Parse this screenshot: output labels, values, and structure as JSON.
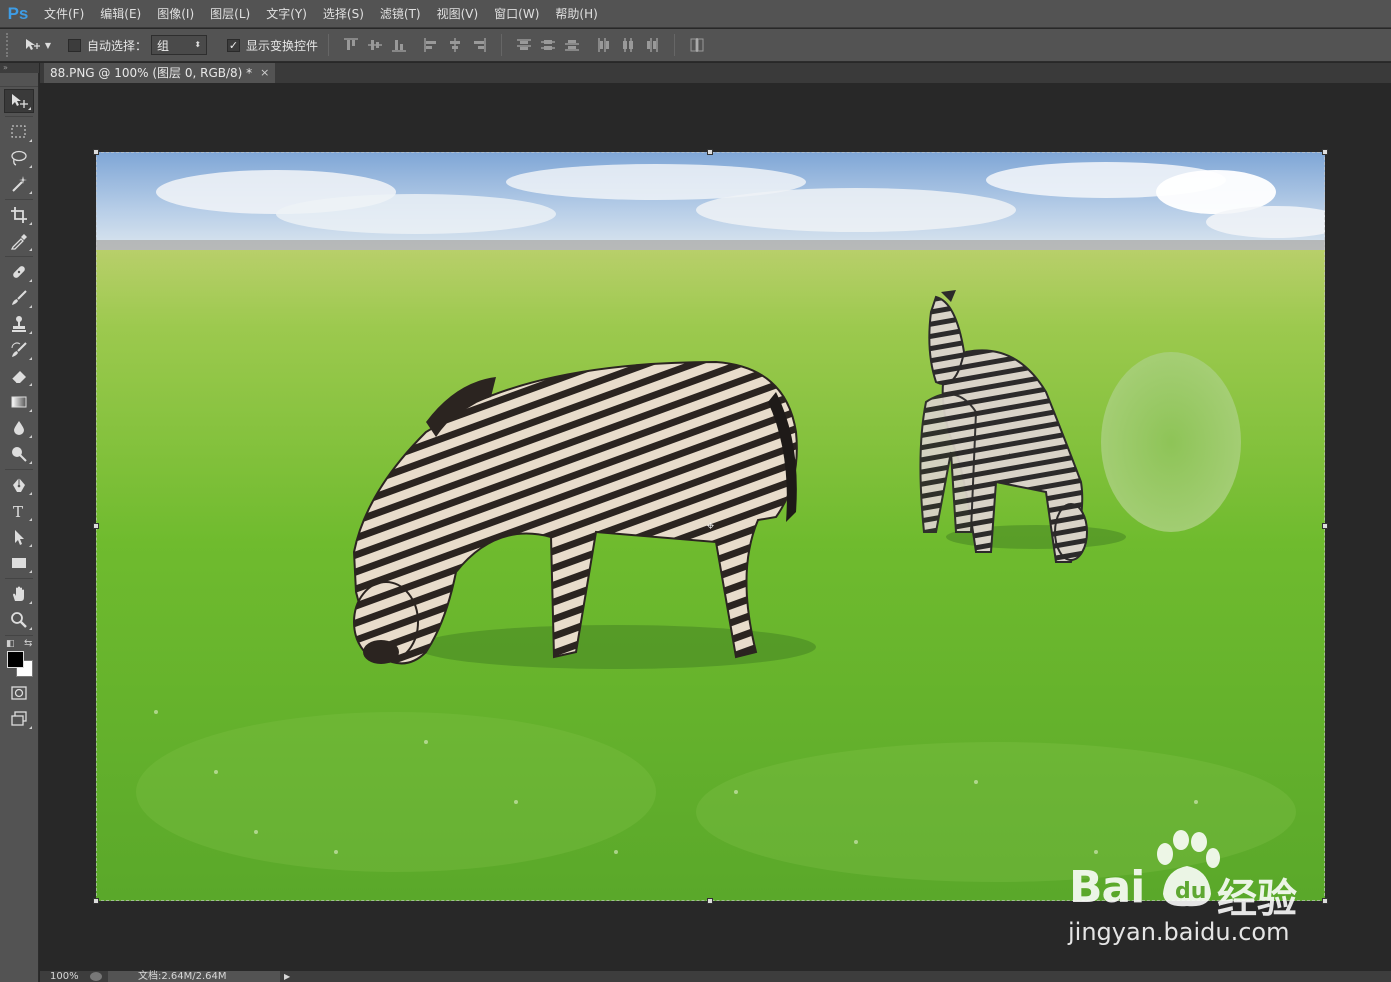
{
  "app": {
    "logo": "Ps"
  },
  "menu": [
    "文件(F)",
    "编辑(E)",
    "图像(I)",
    "图层(L)",
    "文字(Y)",
    "选择(S)",
    "滤镜(T)",
    "视图(V)",
    "窗口(W)",
    "帮助(H)"
  ],
  "options": {
    "auto_select_label": "自动选择：",
    "auto_select_checked": false,
    "auto_select_value": "组",
    "show_transform_label": "显示变换控件",
    "show_transform_checked": true
  },
  "document_tab": {
    "title": "88.PNG @ 100% (图层 0, RGB/8) *",
    "close": "×"
  },
  "tools": [
    "move-tool",
    "rectangular-marquee-tool",
    "lasso-tool",
    "magic-wand-tool",
    "crop-tool",
    "eyedropper-tool",
    "healing-brush-tool",
    "brush-tool",
    "clone-stamp-tool",
    "history-brush-tool",
    "eraser-tool",
    "gradient-tool",
    "blur-tool",
    "dodge-tool",
    "pen-tool",
    "type-tool",
    "path-selection-tool",
    "rectangle-tool",
    "hand-tool",
    "zoom-tool"
  ],
  "colors": {
    "foreground": "#000000",
    "background": "#ffffff"
  },
  "watermark": {
    "brand": "Bai",
    "cn": "经验",
    "url": "jingyan.baidu.com"
  },
  "status": {
    "zoom": "100%",
    "doc_info": "文档:2.64M/2.64M"
  }
}
